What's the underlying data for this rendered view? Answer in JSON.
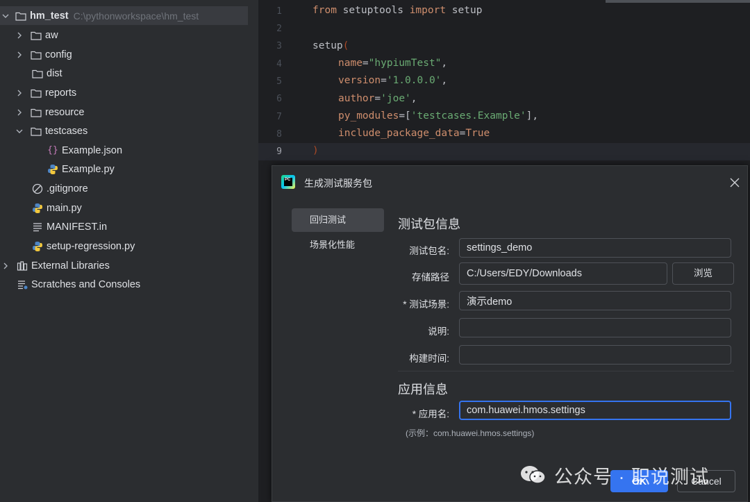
{
  "project_tree": {
    "root": {
      "label": "hm_test",
      "path": "C:\\pythonworkspace\\hm_test"
    },
    "items": [
      {
        "label": "aw"
      },
      {
        "label": "config"
      },
      {
        "label": "dist"
      },
      {
        "label": "reports"
      },
      {
        "label": "resource"
      },
      {
        "label": "testcases"
      },
      {
        "label": "Example.json"
      },
      {
        "label": "Example.py"
      },
      {
        "label": ".gitignore"
      },
      {
        "label": "main.py"
      },
      {
        "label": "MANIFEST.in"
      },
      {
        "label": "setup-regression.py"
      },
      {
        "label": "External Libraries"
      },
      {
        "label": "Scratches and Consoles"
      }
    ]
  },
  "editor": {
    "line_numbers": [
      "1",
      "2",
      "3",
      "4",
      "5",
      "6",
      "7",
      "8",
      "9"
    ],
    "code": {
      "l1_kw1": "from",
      "l1_mod": " setuptools ",
      "l1_kw2": "import",
      "l1_fn": " setup",
      "l3_fn": "setup",
      "l3_par": "(",
      "l4_kw": "name",
      "l4_eq": "=",
      "l4_str": "\"hypiumTest\"",
      "l4_end": ",",
      "l5_kw": "version",
      "l5_eq": "=",
      "l5_str": "'1.0.0.0'",
      "l5_end": ",",
      "l6_kw": "author",
      "l6_eq": "=",
      "l6_str": "'joe'",
      "l6_end": ",",
      "l7_kw": "py_modules",
      "l7_eq": "=[",
      "l7_str": "'testcases.Example'",
      "l7_end": "],",
      "l8_kw": "include_package_data",
      "l8_eq": "=",
      "l8_val": "True",
      "l9_par": ")"
    }
  },
  "dialog": {
    "title": "生成测试服务包",
    "nav": [
      "回归测试",
      "场景化性能"
    ],
    "section_package": "测试包信息",
    "fields": {
      "name_label": "测试包名:",
      "name_value": "settings_demo",
      "path_label": "存储路径",
      "path_value": "C:/Users/EDY/Downloads",
      "browse": "浏览",
      "scene_label": "* 测试场景:",
      "scene_value": "演示demo",
      "desc_label": "说明:",
      "desc_value": "",
      "build_label": "构建时间:",
      "build_value": ""
    },
    "section_app": "应用信息",
    "app": {
      "label": "* 应用名:",
      "value": "com.huawei.hmos.settings",
      "example": "(示例：com.huawei.hmos.settings)"
    },
    "ok": "OK",
    "cancel": "Cancel"
  },
  "watermark": {
    "text": "公众号 · 职说测试"
  },
  "colors": {
    "accent": "#3574f0",
    "keyword": "#cf8e6d",
    "string": "#6aab73"
  }
}
